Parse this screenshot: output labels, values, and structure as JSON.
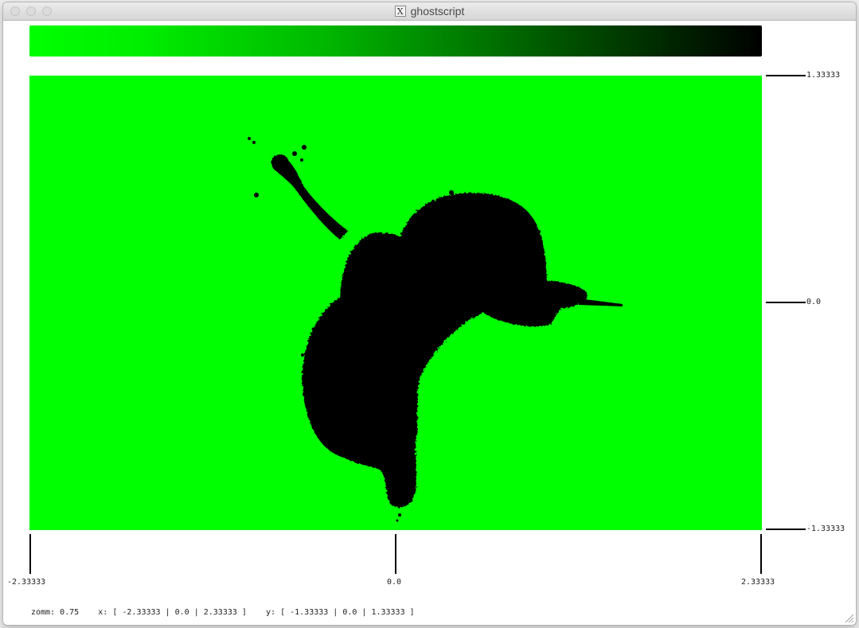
{
  "window": {
    "title": "ghostscript",
    "title_icon": "x11-icon"
  },
  "colorbar": {
    "colors": [
      "#00ff00",
      "#000000"
    ]
  },
  "axes": {
    "y_ticks": [
      "1.33333",
      "0.0",
      "-1.33333"
    ],
    "x_ticks": [
      "-2.33333",
      "0.0",
      "2.33333"
    ]
  },
  "plot": {
    "background_color": "#00ff00",
    "set_color": "#000000"
  },
  "status": {
    "text": "zomm: 0.75    x: [ -2.33333 | 0.0 | 2.33333 ]    y: [ -1.33333 | 0.0 | 1.33333 ]"
  }
}
